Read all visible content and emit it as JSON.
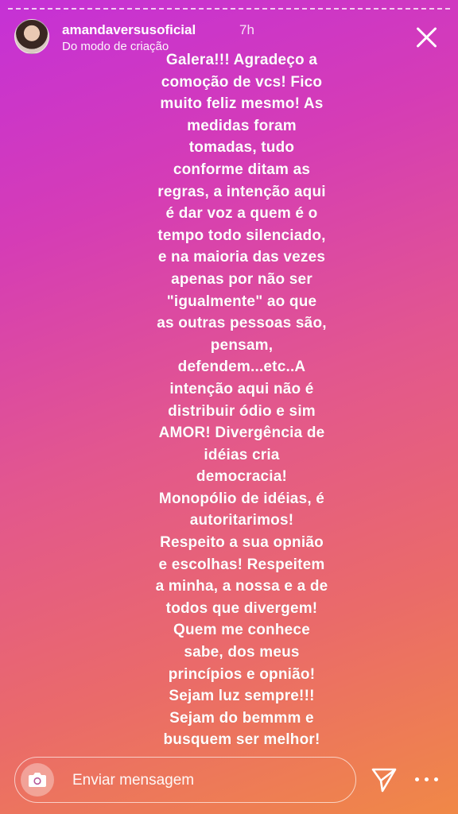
{
  "header": {
    "username": "amandaversusoficial",
    "time": "7h",
    "subtitle": "Do modo de criação"
  },
  "story": {
    "text": "Galera!!! Agradeço a\ncomoção de vcs! Fico\nmuito feliz mesmo! As\nmedidas foram\ntomadas, tudo\nconforme ditam as\nregras, a intenção aqui\né dar voz a quem é o\ntempo todo silenciado,\ne na maioria das vezes\napenas por não ser\n\"igualmente\" ao que\nas outras pessoas são,\npensam,\ndefendem...etc..A\nintenção aqui não é\ndistribuir ódio e sim\nAMOR! Divergência de\nidéias cria\ndemocracia!\nMonopólio de idéias, é\nautoritarimos!\nRespeito a sua opnião\ne escolhas! Respeitem\na minha, a nossa e a de\ntodos que divergem!\nQuem me conhece\nsabe, dos meus\nprincípios e opnião!\nSejam luz sempre!!!\nSejam do bemmm e\nbusquem ser melhor!"
  },
  "reply": {
    "placeholder": "Enviar mensagem"
  },
  "icons": {
    "camera": "camera-icon",
    "send": "send-icon",
    "more": "more-icon",
    "close": "close-icon"
  },
  "colors": {
    "gradient_start": "#c531d6",
    "gradient_end": "#f08847"
  }
}
